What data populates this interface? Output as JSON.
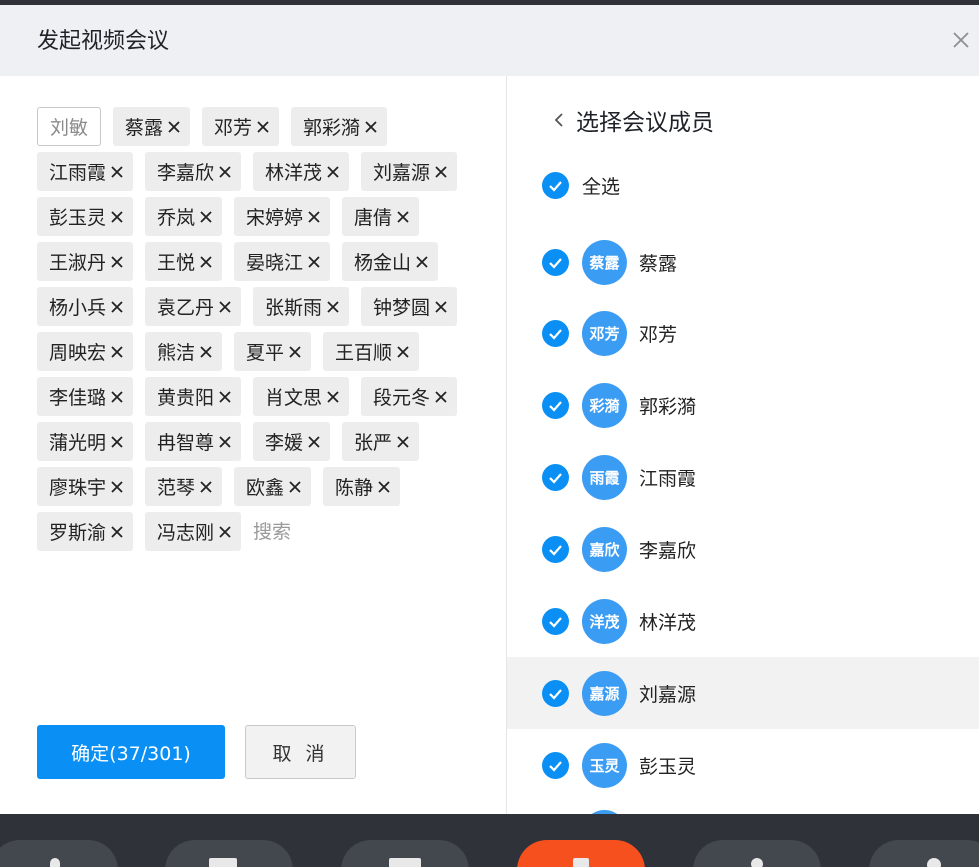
{
  "dialog": {
    "title": "发起视频会议",
    "close_label": "×"
  },
  "left": {
    "current_chip": "刘敏",
    "chips": [
      "蔡露",
      "邓芳",
      "郭彩漪",
      "江雨霞",
      "李嘉欣",
      "林洋茂",
      "刘嘉源",
      "彭玉灵",
      "乔岚",
      "宋婷婷",
      "唐倩",
      "王淑丹",
      "王悦",
      "晏晓江",
      "杨金山",
      "杨小兵",
      "袁乙丹",
      "张斯雨",
      "钟梦圆",
      "周映宏",
      "熊洁",
      "夏平",
      "王百顺",
      "李佳璐",
      "黄贵阳",
      "肖文思",
      "段元冬",
      "蒲光明",
      "冉智尊",
      "李媛",
      "张严",
      "廖珠宇",
      "范琴",
      "欧鑫",
      "陈静",
      "罗斯渝",
      "冯志刚"
    ],
    "search_placeholder": "搜索",
    "confirm_label": "确定(37/301)",
    "cancel_label": "取 消"
  },
  "right": {
    "title": "选择会议成员",
    "select_all_label": "全选",
    "members": [
      {
        "avatar": "蔡露",
        "name": "蔡露",
        "checked": true
      },
      {
        "avatar": "邓芳",
        "name": "邓芳",
        "checked": true
      },
      {
        "avatar": "彩漪",
        "name": "郭彩漪",
        "checked": true
      },
      {
        "avatar": "雨霞",
        "name": "江雨霞",
        "checked": true
      },
      {
        "avatar": "嘉欣",
        "name": "李嘉欣",
        "checked": true
      },
      {
        "avatar": "洋茂",
        "name": "林洋茂",
        "checked": true
      },
      {
        "avatar": "嘉源",
        "name": "刘嘉源",
        "checked": true,
        "highlighted": true
      },
      {
        "avatar": "玉灵",
        "name": "彭玉灵",
        "checked": true
      }
    ]
  },
  "colors": {
    "accent": "#0a90f5",
    "avatar": "#3a9cf3",
    "end_call": "#f5501e",
    "toolbar": "#2f3238"
  },
  "toolbar_icons": [
    "microphone-icon",
    "camera-icon",
    "screen-share-icon",
    "end-call-icon",
    "participants-icon",
    "more-icon"
  ]
}
